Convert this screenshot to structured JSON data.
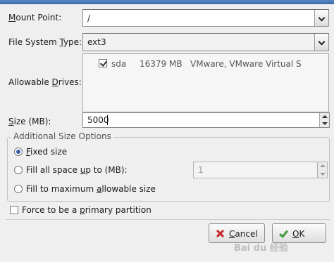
{
  "mount_point": {
    "label_pre": "",
    "label_u": "M",
    "label_post": "ount Point:",
    "value": "/"
  },
  "fs_type": {
    "label_pre": "File System ",
    "label_u": "T",
    "label_post": "ype:",
    "value": "ext3"
  },
  "drives": {
    "label_pre": "Allowable ",
    "label_u": "D",
    "label_post": "rives:",
    "items": [
      {
        "checked": true,
        "name": "sda",
        "size": "16379 MB",
        "model": "VMware, VMware Virtual S"
      }
    ]
  },
  "size": {
    "label_pre": "",
    "label_u": "S",
    "label_post": "ize (MB):",
    "value": "5000"
  },
  "additional": {
    "title": "Additional Size Options",
    "fixed": {
      "pre": "",
      "u": "F",
      "post": "ixed size",
      "selected": true
    },
    "fill_upto": {
      "pre": "Fill all space ",
      "u": "u",
      "post": "p to (MB):",
      "selected": false,
      "value": "1"
    },
    "fill_max": {
      "pre": "Fill to maximum ",
      "u": "a",
      "post": "llowable size",
      "selected": false
    }
  },
  "primary": {
    "pre": "Force to be a ",
    "u": "p",
    "post": "rimary partition",
    "checked": false
  },
  "buttons": {
    "cancel": {
      "pre": "",
      "u": "C",
      "post": "ancel"
    },
    "ok": {
      "pre": "",
      "u": "O",
      "post": "K"
    }
  },
  "watermark": "Bai du 经验"
}
